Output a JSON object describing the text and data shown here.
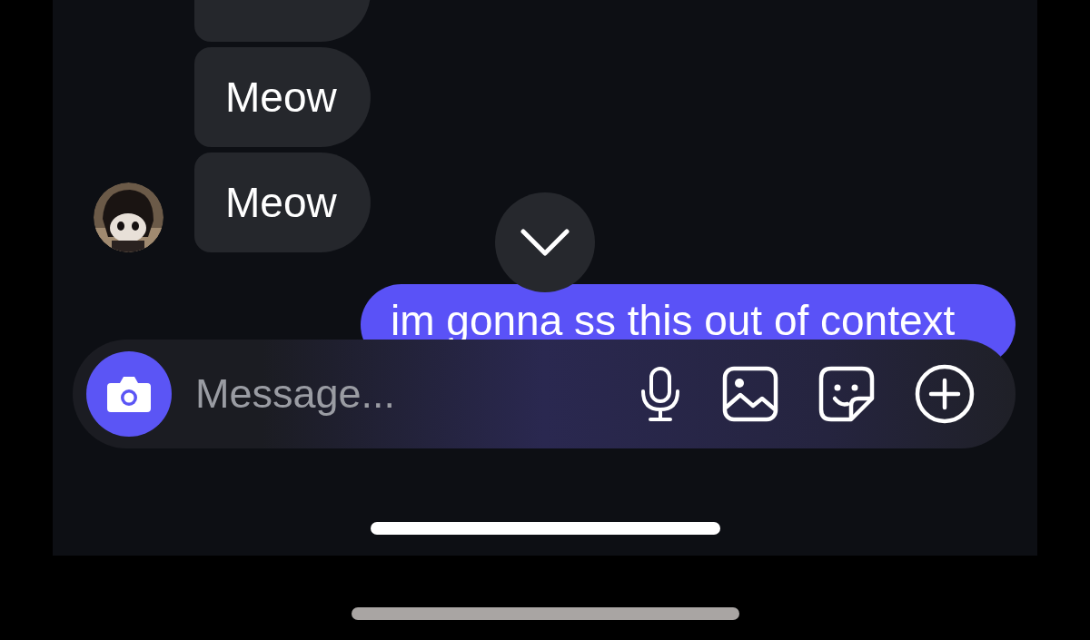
{
  "messages": [
    {
      "kind": "incoming_cut",
      "avatar": false
    },
    {
      "kind": "incoming",
      "text": "Meow",
      "avatar": false
    },
    {
      "kind": "incoming",
      "text": "Meow",
      "avatar": true
    },
    {
      "kind": "outgoing",
      "text": "im gonna ss this out of context",
      "avatar": false
    }
  ],
  "composer": {
    "placeholder": "Message..."
  }
}
